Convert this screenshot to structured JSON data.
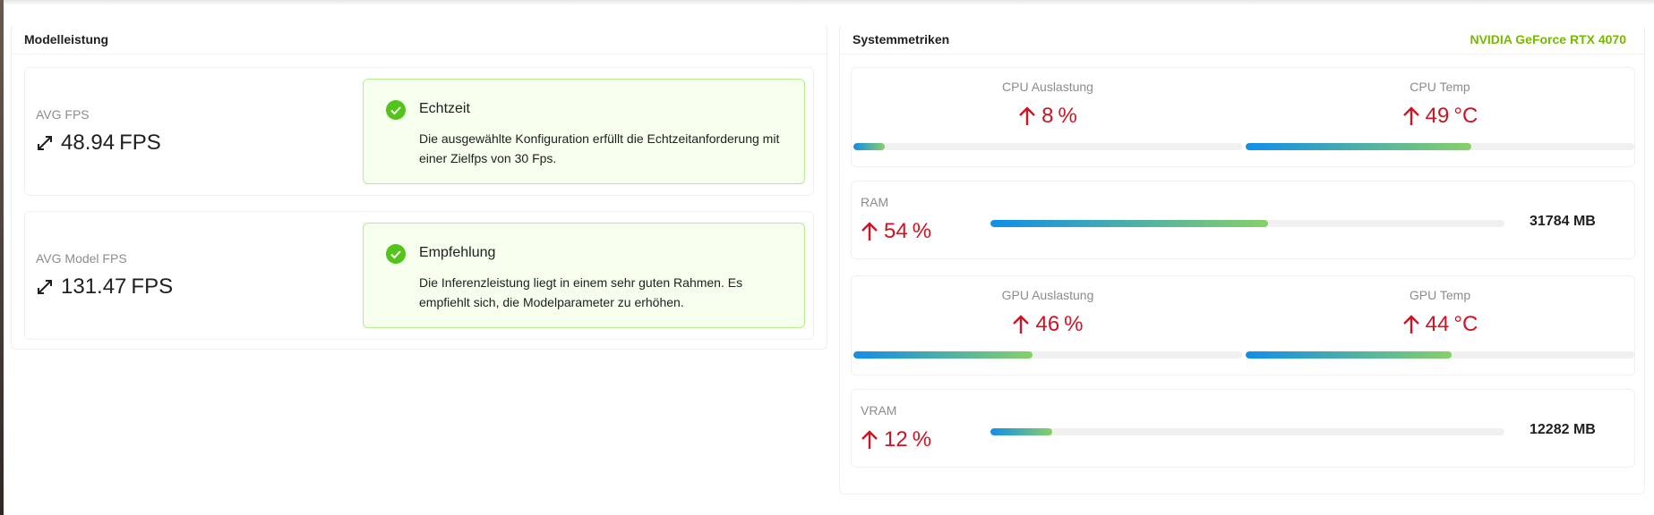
{
  "model_panel": {
    "title": "Modelleistung",
    "cards": [
      {
        "stat_label": "AVG FPS",
        "value": "48.94",
        "unit": "FPS",
        "icon": "expand-arrows-icon",
        "alert": {
          "title": "Echtzeit",
          "description": "Die ausgewählte Konfiguration erfüllt die Echtzeitanforderung mit einer Zielfps von 30 Fps.",
          "icon": "check-circle-icon"
        }
      },
      {
        "stat_label": "AVG Model FPS",
        "value": "131.47",
        "unit": "FPS",
        "icon": "expand-arrows-icon",
        "alert": {
          "title": "Empfehlung",
          "description": "Die Inferenzleistung liegt in einem sehr guten Rahmen. Es empfiehlt sich, die Modelparameter zu erhöhen.",
          "icon": "check-circle-icon"
        }
      }
    ]
  },
  "system_panel": {
    "title": "Systemmetriken",
    "gpu_name": "NVIDIA GeForce RTX 4070",
    "cpu": {
      "usage": {
        "label": "CPU Auslastung",
        "value": "8",
        "unit": "%",
        "fill": 0.08
      },
      "temp": {
        "label": "CPU Temp",
        "value": "49",
        "unit": "°C",
        "fill": 0.58
      }
    },
    "ram": {
      "label": "RAM",
      "value": "54",
      "unit": "%",
      "fill": 0.54,
      "total": "31784 MB"
    },
    "gpu": {
      "usage": {
        "label": "GPU Auslastung",
        "value": "46",
        "unit": "%",
        "fill": 0.46
      },
      "temp": {
        "label": "GPU Temp",
        "value": "44",
        "unit": "°C",
        "fill": 0.53
      }
    },
    "vram": {
      "label": "VRAM",
      "value": "12",
      "unit": "%",
      "fill": 0.12,
      "total": "12282 MB"
    }
  },
  "colors": {
    "accent_green": "#76b900",
    "alert_bg": "#f6ffed",
    "alert_border": "#b7eb8f",
    "success_icon": "#52c41a",
    "up_red": "#cf1322",
    "progress_start": "#108ee9",
    "progress_end": "#87d068"
  }
}
